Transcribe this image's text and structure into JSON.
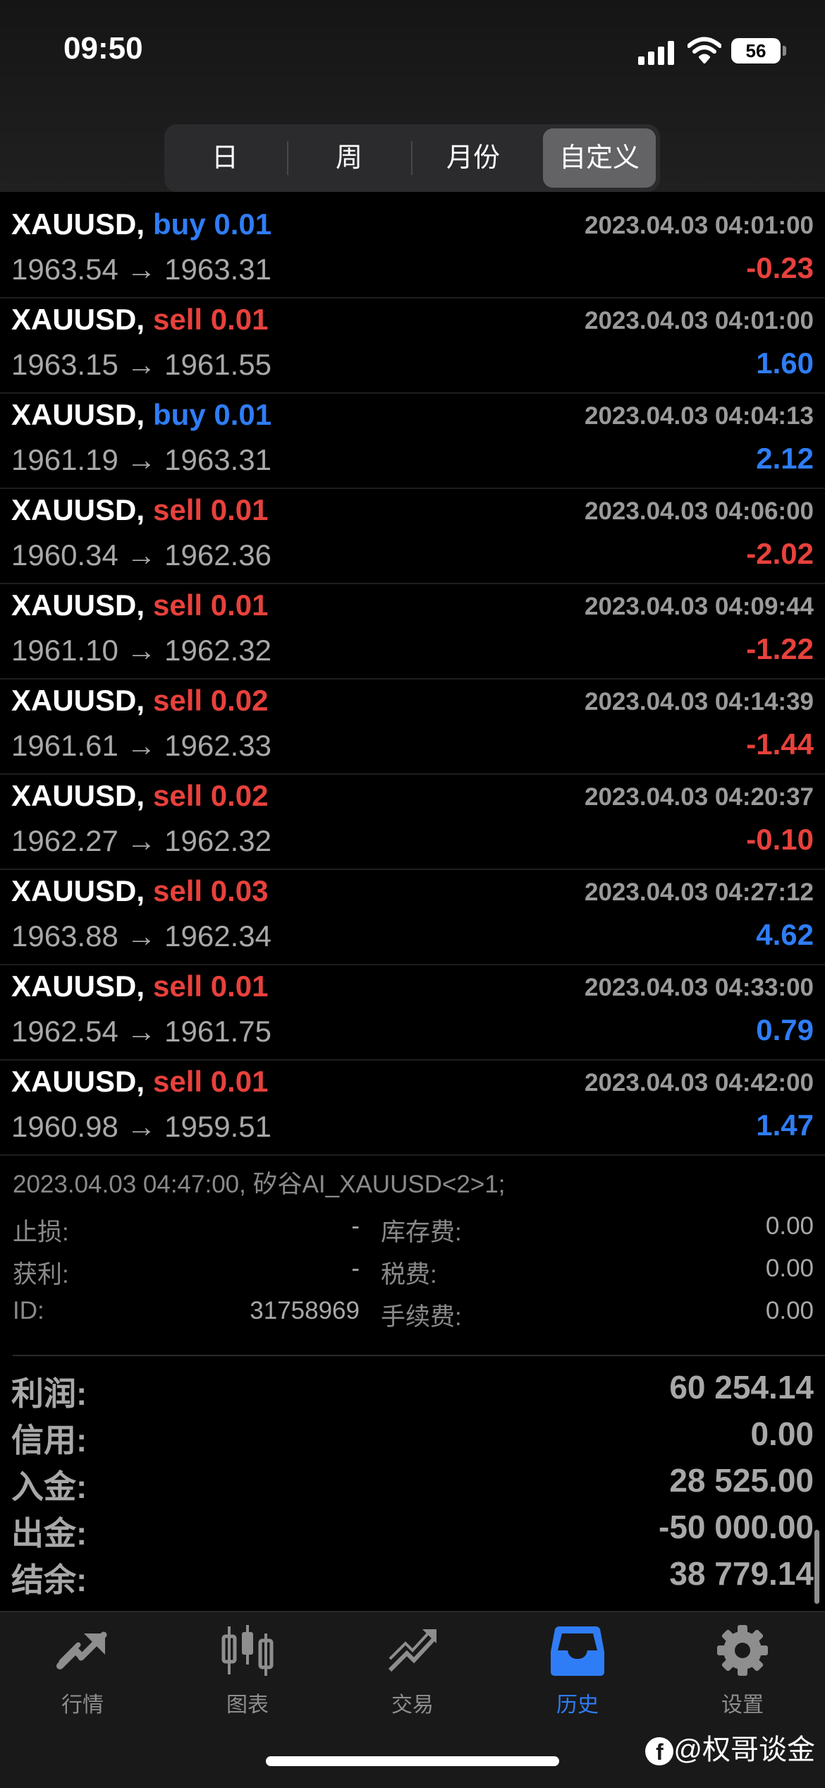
{
  "status_bar": {
    "time": "09:50",
    "battery": "56"
  },
  "segmented": [
    {
      "label": "日",
      "active": false
    },
    {
      "label": "周",
      "active": false
    },
    {
      "label": "月份",
      "active": false
    },
    {
      "label": "自定义",
      "active": true
    }
  ],
  "deals": [
    {
      "symbol": "XAUUSD,",
      "side": "buy 0.01",
      "side_type": "buy",
      "time": "2023.04.03 04:01:00",
      "prices": "1963.54 → 1963.31",
      "profit": "-0.23",
      "profit_type": "sell"
    },
    {
      "symbol": "XAUUSD,",
      "side": "sell 0.01",
      "side_type": "sell",
      "time": "2023.04.03 04:01:00",
      "prices": "1963.15 → 1961.55",
      "profit": "1.60",
      "profit_type": "buy"
    },
    {
      "symbol": "XAUUSD,",
      "side": "buy 0.01",
      "side_type": "buy",
      "time": "2023.04.03 04:04:13",
      "prices": "1961.19 → 1963.31",
      "profit": "2.12",
      "profit_type": "buy"
    },
    {
      "symbol": "XAUUSD,",
      "side": "sell 0.01",
      "side_type": "sell",
      "time": "2023.04.03 04:06:00",
      "prices": "1960.34 → 1962.36",
      "profit": "-2.02",
      "profit_type": "sell"
    },
    {
      "symbol": "XAUUSD,",
      "side": "sell 0.01",
      "side_type": "sell",
      "time": "2023.04.03 04:09:44",
      "prices": "1961.10 → 1962.32",
      "profit": "-1.22",
      "profit_type": "sell"
    },
    {
      "symbol": "XAUUSD,",
      "side": "sell 0.02",
      "side_type": "sell",
      "time": "2023.04.03 04:14:39",
      "prices": "1961.61 → 1962.33",
      "profit": "-1.44",
      "profit_type": "sell"
    },
    {
      "symbol": "XAUUSD,",
      "side": "sell 0.02",
      "side_type": "sell",
      "time": "2023.04.03 04:20:37",
      "prices": "1962.27 → 1962.32",
      "profit": "-0.10",
      "profit_type": "sell"
    },
    {
      "symbol": "XAUUSD,",
      "side": "sell 0.03",
      "side_type": "sell",
      "time": "2023.04.03 04:27:12",
      "prices": "1963.88 → 1962.34",
      "profit": "4.62",
      "profit_type": "buy"
    },
    {
      "symbol": "XAUUSD,",
      "side": "sell 0.01",
      "side_type": "sell",
      "time": "2023.04.03 04:33:00",
      "prices": "1962.54 → 1961.75",
      "profit": "0.79",
      "profit_type": "buy"
    },
    {
      "symbol": "XAUUSD,",
      "side": "sell 0.01",
      "side_type": "sell",
      "time": "2023.04.03 04:42:00",
      "prices": "1960.98 → 1959.51",
      "profit": "1.47",
      "profit_type": "buy"
    }
  ],
  "order_detail": {
    "header": "2023.04.03 04:47:00, 矽谷AI_XAUUSD<2>1;",
    "sl_label": "止损:",
    "sl_value": "-",
    "tp_label": "获利:",
    "tp_value": "-",
    "id_label": "ID:",
    "id_value": "31758969",
    "swap_label": "库存费:",
    "swap_value": "0.00",
    "tax_label": "税费:",
    "tax_value": "0.00",
    "fee_label": "手续费:",
    "fee_value": "0.00"
  },
  "summary": [
    {
      "label": "利润:",
      "value": "60 254.14"
    },
    {
      "label": "信用:",
      "value": "0.00"
    },
    {
      "label": "入金:",
      "value": "28 525.00"
    },
    {
      "label": "出金:",
      "value": "-50 000.00"
    },
    {
      "label": "结余:",
      "value": "38 779.14"
    }
  ],
  "tabbar": [
    {
      "label": "行情",
      "icon": "quotes-icon",
      "active": false
    },
    {
      "label": "图表",
      "icon": "chart-icon",
      "active": false
    },
    {
      "label": "交易",
      "icon": "trade-icon",
      "active": false
    },
    {
      "label": "历史",
      "icon": "history-icon",
      "active": true
    },
    {
      "label": "设置",
      "icon": "settings-icon",
      "active": false
    }
  ],
  "colors": {
    "buy": "#2f7df6",
    "sell": "#e8413c",
    "muted": "#a8a8a8"
  },
  "watermark": "@权哥谈金"
}
